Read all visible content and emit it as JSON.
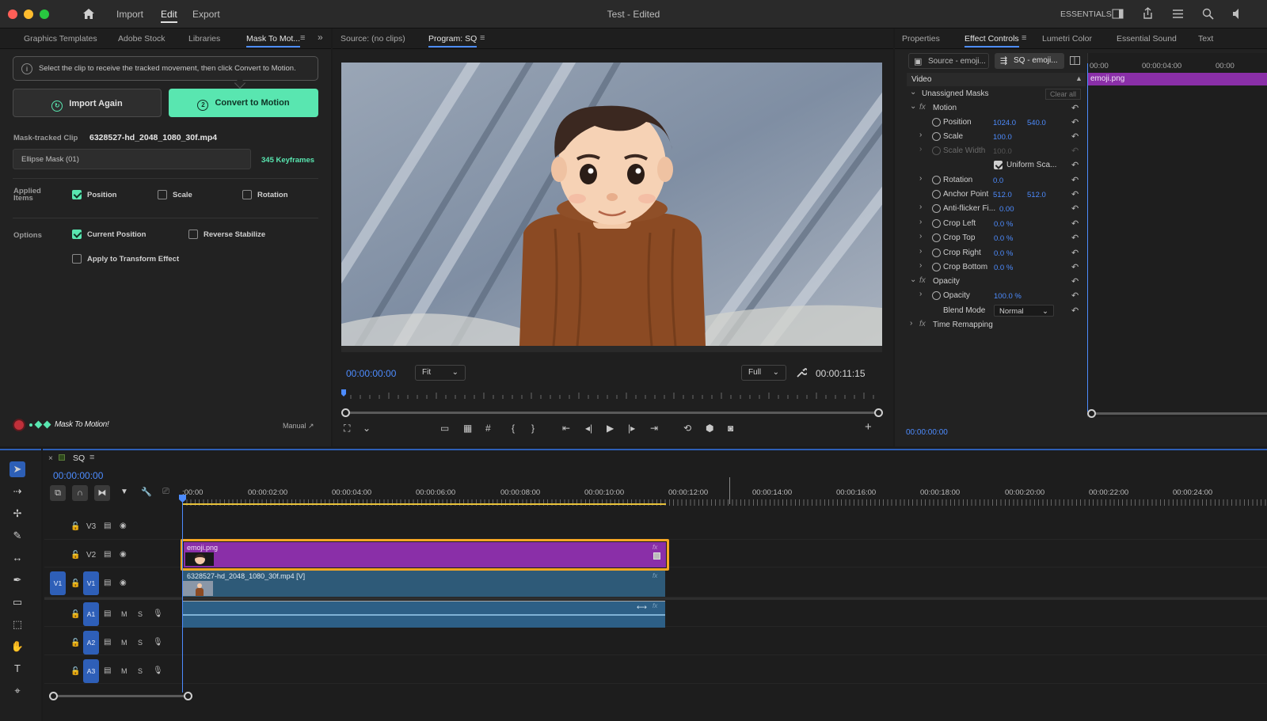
{
  "app": {
    "title": "Test - Edited",
    "menu": [
      "Import",
      "Edit",
      "Export"
    ],
    "active_menu": "Edit",
    "workspace": "ESSENTIALS"
  },
  "left_panel": {
    "tabs": [
      "Graphics Templates",
      "Adobe Stock",
      "Libraries",
      "Mask To Mot..."
    ],
    "active_tab": "Mask To Mot...",
    "info_text": "Select the clip to receive the tracked movement, then click Convert to Motion.",
    "import_again_label": "Import Again",
    "convert_step": "2",
    "convert_label": "Convert to Motion",
    "mask_tracked_label": "Mask-tracked Clip",
    "mask_tracked_clip": "6328527-hd_2048_1080_30f.mp4",
    "mask_select": "Ellipse Mask (01)",
    "keyframes": "345 Keyframes",
    "applied_label": "Applied Items",
    "applied_items": [
      {
        "label": "Position",
        "checked": true
      },
      {
        "label": "Scale",
        "checked": false
      },
      {
        "label": "Rotation",
        "checked": false
      }
    ],
    "options_label": "Options",
    "options": [
      {
        "label": "Current Position",
        "checked": true
      },
      {
        "label": "Reverse Stabilize",
        "checked": false
      },
      {
        "label": "Apply to Transform Effect",
        "checked": false
      }
    ],
    "brand": "Mask To Motion!",
    "manual_link": "Manual ↗"
  },
  "monitor": {
    "source_tab": "Source: (no clips)",
    "program_tab": "Program: SQ",
    "timecode_in": "00:00:00:00",
    "zoom": "Fit",
    "quality": "Full",
    "timecode_out": "00:00:11:15"
  },
  "effect_controls": {
    "tabs": [
      "Properties",
      "Effect Controls",
      "Lumetri Color",
      "Essential Sound",
      "Text"
    ],
    "active_tab": "Effect Controls",
    "source_btn": "Source - emoji...",
    "seq_btn": "SQ - emoji...",
    "section": "Video",
    "unassigned_masks": "Unassigned Masks",
    "clear_all": "Clear all",
    "motion": "Motion",
    "position": {
      "label": "Position",
      "x": "1024.0",
      "y": "540.0"
    },
    "scale": {
      "label": "Scale",
      "value": "100.0"
    },
    "scale_width": {
      "label": "Scale Width",
      "value": "100.0"
    },
    "uniform_scale": "Uniform Sca...",
    "rotation": {
      "label": "Rotation",
      "value": "0.0"
    },
    "anchor": {
      "label": "Anchor Point",
      "x": "512.0",
      "y": "512.0"
    },
    "antiflicker": {
      "label": "Anti-flicker Fi...",
      "value": "0.00"
    },
    "crop_left": {
      "label": "Crop Left",
      "value": "0.0 %"
    },
    "crop_top": {
      "label": "Crop Top",
      "value": "0.0 %"
    },
    "crop_right": {
      "label": "Crop Right",
      "value": "0.0 %"
    },
    "crop_bottom": {
      "label": "Crop Bottom",
      "value": "0.0 %"
    },
    "opacity_group": "Opacity",
    "opacity": {
      "label": "Opacity",
      "value": "100.0 %"
    },
    "blend": {
      "label": "Blend Mode",
      "value": "Normal"
    },
    "time_remapping": "Time Remapping",
    "mini_ruler": [
      "00:00",
      "00:00:04:00",
      "00:00"
    ],
    "mini_clip": "emoji.png",
    "timecode": "00:00:00:00"
  },
  "timeline": {
    "sequence": "SQ",
    "timecode": "00:00:00:00",
    "ruler": [
      ":00:00",
      "00:00:02:00",
      "00:00:04:00",
      "00:00:06:00",
      "00:00:08:00",
      "00:00:10:00",
      "00:00:12:00",
      "00:00:14:00",
      "00:00:16:00",
      "00:00:18:00",
      "00:00:20:00",
      "00:00:22:00",
      "00:00:24:00"
    ],
    "tracks": {
      "v3": "V3",
      "v2": "V2",
      "v1": "V1",
      "a1": "A1",
      "a2": "A2",
      "a3": "A3"
    },
    "src_v1": "V1",
    "clip_emoji": "emoji.png",
    "clip_video": "6328527-hd_2048_1080_30f.mp4 [V]",
    "m": "M",
    "s": "S"
  },
  "colors": {
    "accent_blue": "#4d8cff",
    "mint": "#59e6b0",
    "emoji_clip": "#8a2fa8",
    "video_clip": "#2e5a78",
    "selection": "#f5a623"
  }
}
